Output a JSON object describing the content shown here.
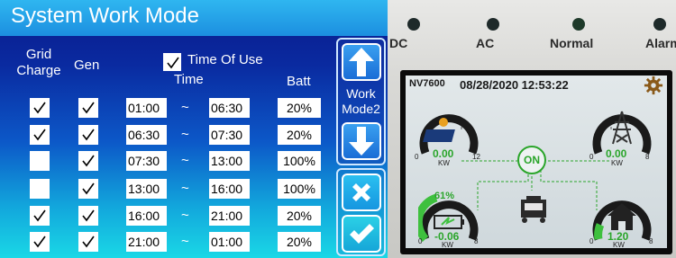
{
  "left": {
    "title": "System Work Mode",
    "headers": {
      "grid_charge": "Grid\nCharge",
      "gen": "Gen",
      "time_of_use": "Time Of Use",
      "time": "Time",
      "batt": "Batt"
    },
    "rows": [
      {
        "grid": true,
        "gen": true,
        "start": "01:00",
        "end": "06:30",
        "batt": "20%"
      },
      {
        "grid": true,
        "gen": true,
        "start": "06:30",
        "end": "07:30",
        "batt": "20%"
      },
      {
        "grid": false,
        "gen": true,
        "start": "07:30",
        "end": "13:00",
        "batt": "100%"
      },
      {
        "grid": false,
        "gen": true,
        "start": "13:00",
        "end": "16:00",
        "batt": "100%"
      },
      {
        "grid": true,
        "gen": true,
        "start": "16:00",
        "end": "21:00",
        "batt": "20%"
      },
      {
        "grid": true,
        "gen": true,
        "start": "21:00",
        "end": "01:00",
        "batt": "20%"
      }
    ],
    "tilde": "~",
    "mode_label": "Work\nMode2"
  },
  "right": {
    "leds": [
      {
        "label": "DC",
        "color": "#1e2a2a"
      },
      {
        "label": "AC",
        "color": "#1e2a2a"
      },
      {
        "label": "Normal",
        "color": "#1e3a2a"
      },
      {
        "label": "Alarm",
        "color": "#1e2a2a"
      }
    ],
    "model": "NV7600",
    "datetime": "08/28/2020 12:53:22",
    "on_label": "ON",
    "pv": {
      "value": "0.00",
      "unit": "KW",
      "min": "0",
      "max": "12"
    },
    "grid": {
      "value": "0.00",
      "unit": "KW",
      "min": "0",
      "max": "8"
    },
    "battery": {
      "soc": "61%",
      "value": "-0.06",
      "unit": "KW",
      "min": "0",
      "max": "8"
    },
    "load": {
      "value": "1.20",
      "unit": "KW",
      "min": "0",
      "max": "8"
    }
  }
}
